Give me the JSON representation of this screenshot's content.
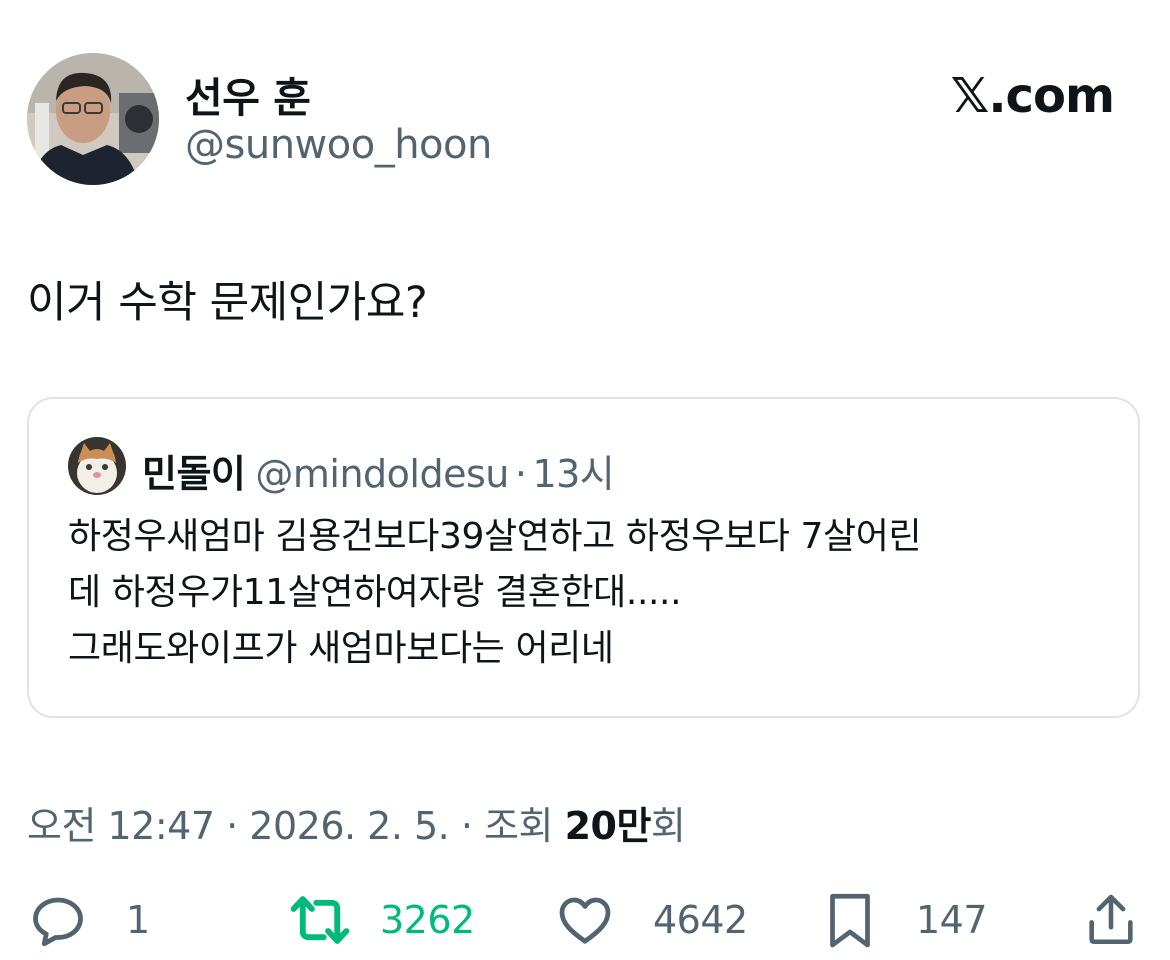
{
  "author": {
    "display_name": "선우 훈",
    "handle": "@sunwoo_hoon",
    "avatar_icon": "profile-photo"
  },
  "brand": "𝕏.com",
  "tweet": {
    "text": "이거 수학 문제인가요?"
  },
  "quote": {
    "display_name": "민돌이",
    "handle": "@mindoldesu",
    "separator": "·",
    "time": "13시",
    "avatar_icon": "cat-profile-photo",
    "lines": [
      "하정우새엄마 김용건보다39살연하고 하정우보다 7살어린",
      "데 하정우가11살연하여자랑 결혼한대.....",
      "그래도와이프가 새엄마보다는 어리네"
    ]
  },
  "meta": {
    "time": "오전 12:47",
    "sep1": "·",
    "date": "2026. 2. 5.",
    "sep2": "·",
    "views_label": "조회",
    "views_number": "20만",
    "views_suffix": "회"
  },
  "actions": {
    "reply_count": "1",
    "retweet_count": "3262",
    "like_count": "4642",
    "bookmark_count": "147",
    "retweet_color": "#00ba7c",
    "icons": [
      "reply-icon",
      "retweet-icon",
      "like-icon",
      "bookmark-icon",
      "share-icon"
    ]
  }
}
